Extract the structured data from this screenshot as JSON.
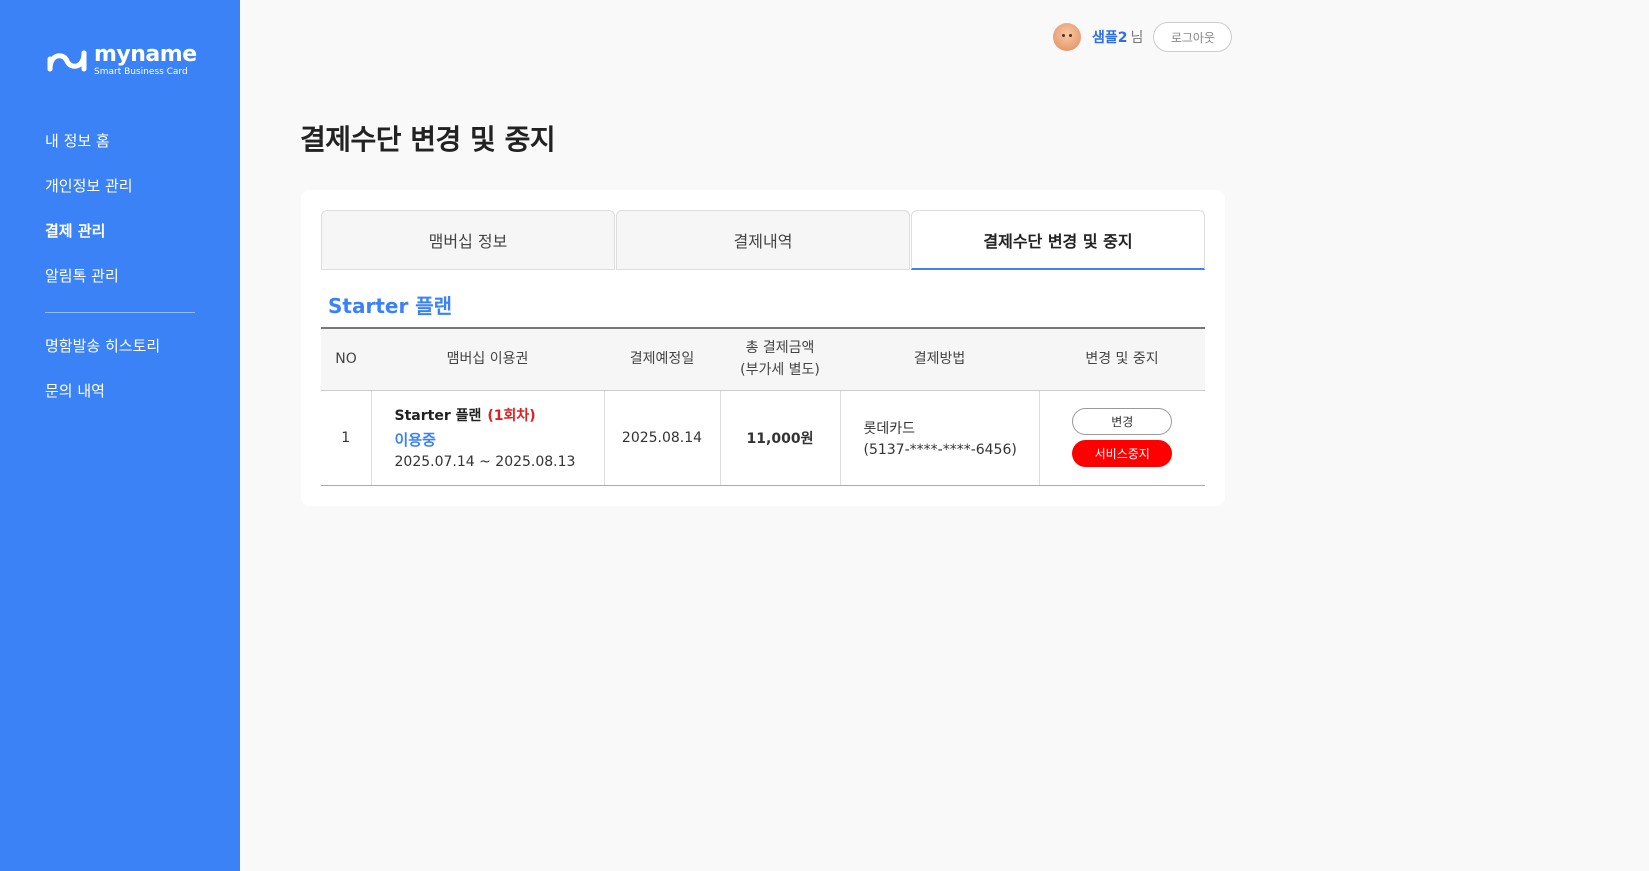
{
  "brand": {
    "name": "myname",
    "tagline": "Smart Business Card"
  },
  "sidebar": {
    "items": [
      {
        "label": "내 정보 홈"
      },
      {
        "label": "개인정보 관리"
      },
      {
        "label": "결제 관리"
      },
      {
        "label": "알림톡 관리"
      },
      {
        "label": "명함발송 히스토리"
      },
      {
        "label": "문의 내역"
      }
    ],
    "active": "결제 관리"
  },
  "header": {
    "username": "샘플2",
    "suffix": "님",
    "logout_label": "로그아웃"
  },
  "page": {
    "title": "결제수단 변경 및 중지"
  },
  "tabs": [
    {
      "label": "맴버십 정보"
    },
    {
      "label": "결제내역"
    },
    {
      "label": "결제수단 변경 및 중지"
    }
  ],
  "plan_title": "Starter 플랜",
  "table": {
    "headers": {
      "no": "NO",
      "membership": "맴버십 이용권",
      "due_date": "결제예정일",
      "total_line1": "총 결제금액",
      "total_line2": "(부가세 별도)",
      "method": "결제방법",
      "action": "변경 및 중지"
    },
    "rows": [
      {
        "no": "1",
        "plan": "Starter 플랜",
        "round": "(1회차)",
        "status": "이용중",
        "period": "2025.07.14 ~ 2025.08.13",
        "due_date": "2025.08.14",
        "amount": "11,000원",
        "method_name": "롯데카드",
        "method_number": "(5137-****-****-6456)",
        "change_label": "변경",
        "stop_label": "서비스중지"
      }
    ]
  },
  "colors": {
    "primary": "#3b82f6",
    "danger": "#ff0000",
    "background": "#f9f9f9"
  }
}
